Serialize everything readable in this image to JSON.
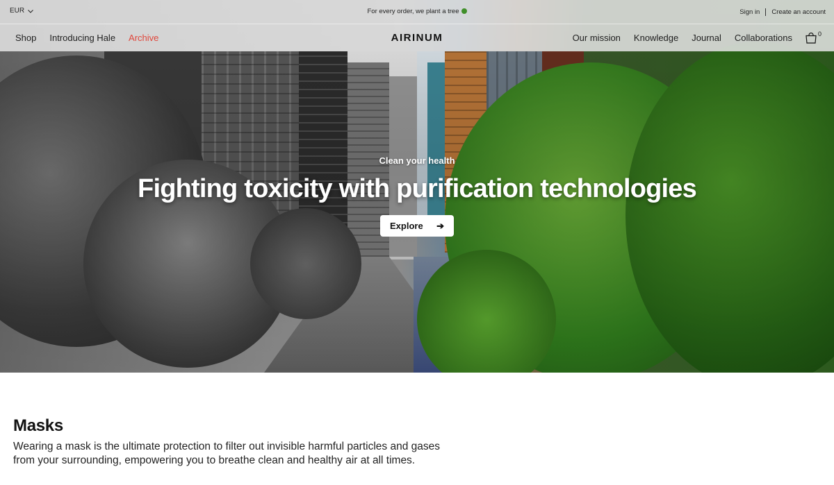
{
  "topbar": {
    "currency": "EUR",
    "promo": "For every order, we plant a tree",
    "sign_in": "Sign in",
    "create_account": "Create an account"
  },
  "nav": {
    "logo": "AIRINUM",
    "left_items": [
      {
        "label": "Shop"
      },
      {
        "label": "Introducing Hale"
      },
      {
        "label": "Archive"
      }
    ],
    "right_items": [
      {
        "label": "Our mission"
      },
      {
        "label": "Knowledge"
      },
      {
        "label": "Journal"
      },
      {
        "label": "Collaborations"
      }
    ],
    "cart_count": "0",
    "accent_color": "#e0463b"
  },
  "hero": {
    "eyebrow": "Clean your health",
    "headline": "Fighting toxicity with purification technologies",
    "cta_label": "Explore",
    "cta_arrow": "➔"
  },
  "masks": {
    "title": "Masks",
    "description": "Wearing a mask is the ultimate protection to filter out invisible harmful particles and gases from your surrounding, empowering you to breathe clean and healthy air at all times."
  },
  "icons": {
    "currency_dropdown": "chevron-down-icon",
    "cart": "shopping-bag-icon",
    "promo": "tree-icon"
  }
}
